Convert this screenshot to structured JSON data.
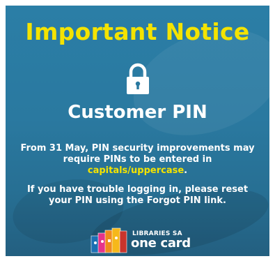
{
  "notice": {
    "title": "Important Notice",
    "subtitle": "Customer PIN",
    "lock_icon": "padlock-icon",
    "paragraph1_prefix": "From 31 May, PIN security improvements may require PINs to be entered in ",
    "paragraph1_highlight": "capitals/uppercase",
    "paragraph1_suffix": ".",
    "paragraph2": "If you have trouble logging in, please reset your PIN using the Forgot PIN link."
  },
  "logo": {
    "line1": "LIBRARIES SA",
    "line2": "one card"
  },
  "colors": {
    "background": "#2a79a0",
    "title": "#f4e300",
    "text": "#ffffff",
    "highlight": "#f4e300"
  }
}
